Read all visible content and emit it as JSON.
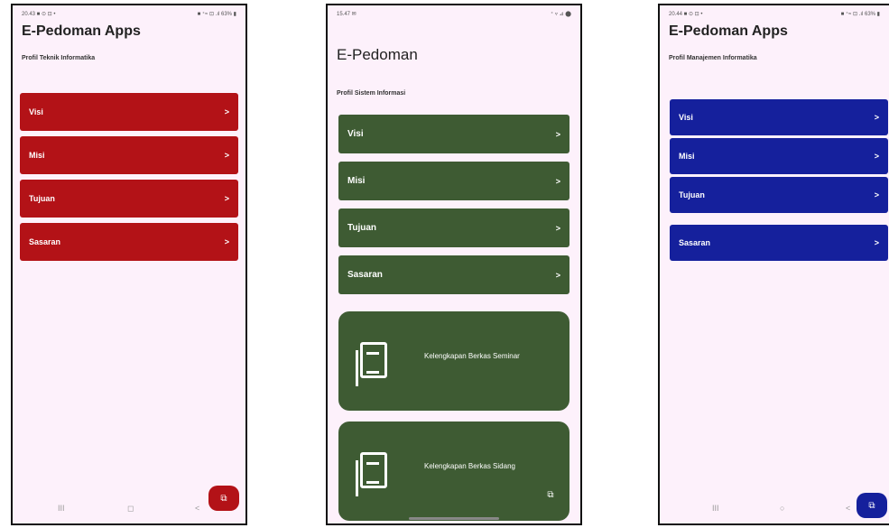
{
  "phones": [
    {
      "status": {
        "time": "20.43 ■ ⊙ ⊡ •",
        "icons": "■ ⁺≈ ⊡ .ıl 63% ▮"
      },
      "title": "E-Pedoman Apps",
      "subtitle": "Profil Teknik Informatika",
      "items": [
        {
          "label": "Visi",
          "chevron": ">"
        },
        {
          "label": "Misi",
          "chevron": ">"
        },
        {
          "label": "Tujuan",
          "chevron": ">"
        },
        {
          "label": "Sasaran",
          "chevron": ">"
        }
      ],
      "accent": "#b31217",
      "fab_icon": "docs-icon",
      "nav": {
        "recent": "III",
        "home": "◻",
        "back": "<"
      }
    },
    {
      "status": {
        "time": "15.47 ✉",
        "icons": "⁺ ▿ ⊿ ⬤"
      },
      "title": "E-Pedoman",
      "subtitle": "Profil Sistem Informasi",
      "items": [
        {
          "label": "Visi",
          "chevron": ">"
        },
        {
          "label": "Misi",
          "chevron": ">"
        },
        {
          "label": "Tujuan",
          "chevron": ">"
        },
        {
          "label": "Sasaran",
          "chevron": ">"
        }
      ],
      "big_cards": [
        {
          "label": "Kelengkapan Berkas Seminar",
          "icon": "document-list-icon"
        },
        {
          "label": "Kelengkapan Berkas Sidang",
          "icon": "document-list-icon"
        }
      ],
      "accent": "#3e5b33",
      "fab_icon": "docs-icon"
    },
    {
      "status": {
        "time": "20.44 ■ ⊙ ⊡ •",
        "icons": "■ ⁺≈ ⊡ .ıl 63% ▮"
      },
      "title": "E-Pedoman Apps",
      "subtitle": "Profil Manajemen Informatika",
      "items": [
        {
          "label": "Visi",
          "chevron": ">"
        },
        {
          "label": "Misi",
          "chevron": ">"
        },
        {
          "label": "Tujuan",
          "chevron": ">"
        },
        {
          "label": "Sasaran",
          "chevron": ">"
        }
      ],
      "accent": "#15209c",
      "fab_icon": "docs-icon",
      "nav": {
        "recent": "III",
        "home": "○",
        "back": "<"
      }
    }
  ]
}
